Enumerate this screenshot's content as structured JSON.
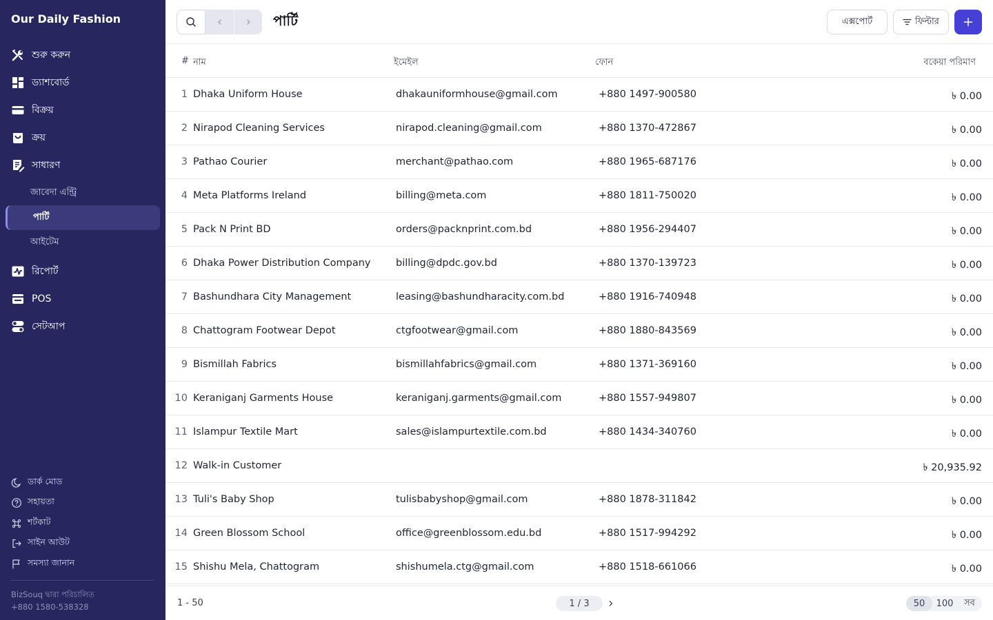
{
  "brand": "Our Daily Fashion",
  "sidebar": {
    "items": [
      {
        "label": "শুরু করুন",
        "icon": "tools-icon"
      },
      {
        "label": "ড্যাশবোর্ড",
        "icon": "dashboard-icon"
      },
      {
        "label": "বিক্রয়",
        "icon": "card-icon"
      },
      {
        "label": "ক্রয়",
        "icon": "bag-icon"
      },
      {
        "label": "সাধারণ",
        "icon": "document-edit-icon"
      }
    ],
    "sub_items": [
      {
        "label": "জাবেদা এন্ট্রি"
      },
      {
        "label": "পার্টি"
      },
      {
        "label": "আইটেম"
      }
    ],
    "items_after": [
      {
        "label": "রিপোর্ট",
        "icon": "pulse-icon"
      },
      {
        "label": "POS",
        "icon": "pos-icon"
      },
      {
        "label": "সেটআপ",
        "icon": "toggle-icon"
      }
    ],
    "footer_items": [
      {
        "label": "ডার্ক মোড",
        "icon": "moon-icon"
      },
      {
        "label": "সহায়তা",
        "icon": "help-icon"
      },
      {
        "label": "শর্টকাট",
        "icon": "command-icon"
      },
      {
        "label": "সাইন আউট",
        "icon": "sign-out-icon"
      },
      {
        "label": "সমস্যা জানান",
        "icon": "flag-icon"
      }
    ],
    "powered_by": "BizSouq দ্বারা পরিচালিত",
    "support_phone": "+880 1580-538328"
  },
  "header": {
    "title": "পার্টি",
    "export_label": "এক্সপোর্ট",
    "filter_label": "ফিল্টার"
  },
  "colors": {
    "sidebar_bg": "#27265f",
    "accent": "#4640d6"
  },
  "table": {
    "columns": [
      "#",
      "নাম",
      "ইমেইল",
      "ফোন",
      "বকেয়া পরিমাণ"
    ],
    "rows": [
      {
        "num": "1",
        "name": "Dhaka Uniform House",
        "email": "dhakauniformhouse@gmail.com",
        "phone": "+880 1497-900580",
        "due": "৳ 0.00"
      },
      {
        "num": "2",
        "name": "Nirapod Cleaning Services",
        "email": "nirapod.cleaning@gmail.com",
        "phone": "+880 1370-472867",
        "due": "৳ 0.00"
      },
      {
        "num": "3",
        "name": "Pathao Courier",
        "email": "merchant@pathao.com",
        "phone": "+880 1965-687176",
        "due": "৳ 0.00"
      },
      {
        "num": "4",
        "name": "Meta Platforms Ireland",
        "email": "billing@meta.com",
        "phone": "+880 1811-750020",
        "due": "৳ 0.00"
      },
      {
        "num": "5",
        "name": "Pack N Print BD",
        "email": "orders@packnprint.com.bd",
        "phone": "+880 1956-294407",
        "due": "৳ 0.00"
      },
      {
        "num": "6",
        "name": "Dhaka Power Distribution Company",
        "email": "billing@dpdc.gov.bd",
        "phone": "+880 1370-139723",
        "due": "৳ 0.00"
      },
      {
        "num": "7",
        "name": "Bashundhara City Management",
        "email": "leasing@bashundharacity.com.bd",
        "phone": "+880 1916-740948",
        "due": "৳ 0.00"
      },
      {
        "num": "8",
        "name": "Chattogram Footwear Depot",
        "email": "ctgfootwear@gmail.com",
        "phone": "+880 1880-843569",
        "due": "৳ 0.00"
      },
      {
        "num": "9",
        "name": "Bismillah Fabrics",
        "email": "bismillahfabrics@gmail.com",
        "phone": "+880 1371-369160",
        "due": "৳ 0.00"
      },
      {
        "num": "10",
        "name": "Keraniganj Garments House",
        "email": "keraniganj.garments@gmail.com",
        "phone": "+880 1557-949807",
        "due": "৳ 0.00"
      },
      {
        "num": "11",
        "name": "Islampur Textile Mart",
        "email": "sales@islampurtextile.com.bd",
        "phone": "+880 1434-340760",
        "due": "৳ 0.00"
      },
      {
        "num": "12",
        "name": "Walk-in Customer",
        "email": "",
        "phone": "",
        "due": "৳ 20,935.92"
      },
      {
        "num": "13",
        "name": "Tuli's Baby Shop",
        "email": "tulisbabyshop@gmail.com",
        "phone": "+880 1878-311842",
        "due": "৳ 0.00"
      },
      {
        "num": "14",
        "name": "Green Blossom School",
        "email": "office@greenblossom.edu.bd",
        "phone": "+880 1517-994292",
        "due": "৳ 0.00"
      },
      {
        "num": "15",
        "name": "Shishu Mela, Chattogram",
        "email": "shishumela.ctg@gmail.com",
        "phone": "+880 1518-661066",
        "due": "৳ 0.00"
      }
    ]
  },
  "footer": {
    "range": "1 - 50",
    "page_indicator": "1 / 3",
    "page_sizes": [
      "50",
      "100",
      "সব"
    ],
    "selected_page_size": "50"
  }
}
